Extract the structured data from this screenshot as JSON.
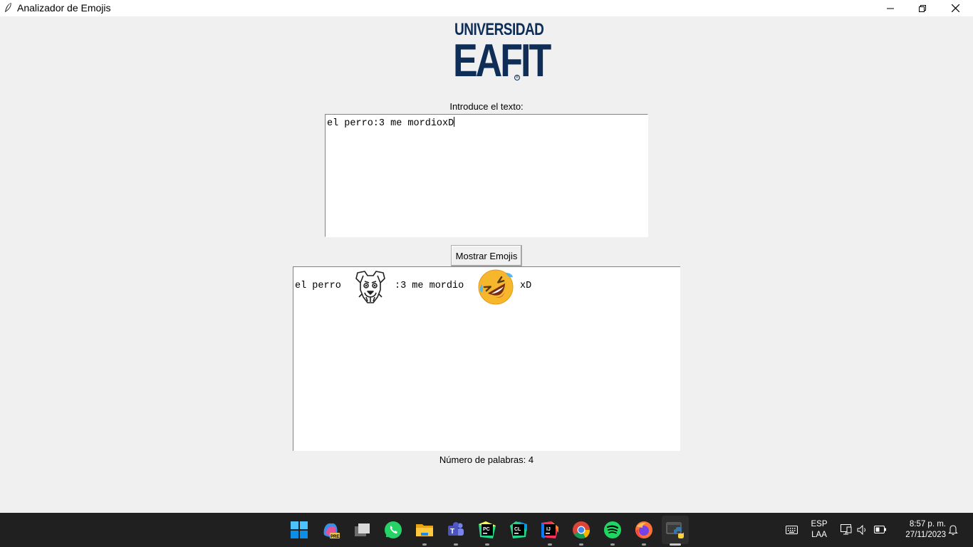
{
  "window": {
    "title": "Analizador de Emojis"
  },
  "logo": {
    "line1": "UNIVERSIDAD",
    "line2": "EAFIT",
    "reg_mark": "®"
  },
  "form": {
    "prompt_label": "Introduce el texto:",
    "input_text": "el perro:3 me mordioxD",
    "button_label": "Mostrar Emojis"
  },
  "output": {
    "segment1": "el perro",
    "emoji1": "dog-face-icon",
    "segment2": ":3 me mordio",
    "emoji2": "rolling-on-floor-laughing-icon",
    "segment3": "xD"
  },
  "word_count_label": "Número de palabras: 4",
  "taskbar": {
    "apps": [
      "start",
      "copilot-pre",
      "task-view",
      "whatsapp",
      "file-explorer",
      "teams",
      "pycharm",
      "clion",
      "intellij",
      "chrome",
      "spotify",
      "firefox",
      "python"
    ],
    "language_line1": "ESP",
    "language_line2": "LAA",
    "time": "8:57 p. m.",
    "date": "27/11/2023"
  },
  "colors": {
    "brand": "#0f2e57",
    "taskbar": "#202020",
    "window_bg": "#f0f0f0"
  }
}
